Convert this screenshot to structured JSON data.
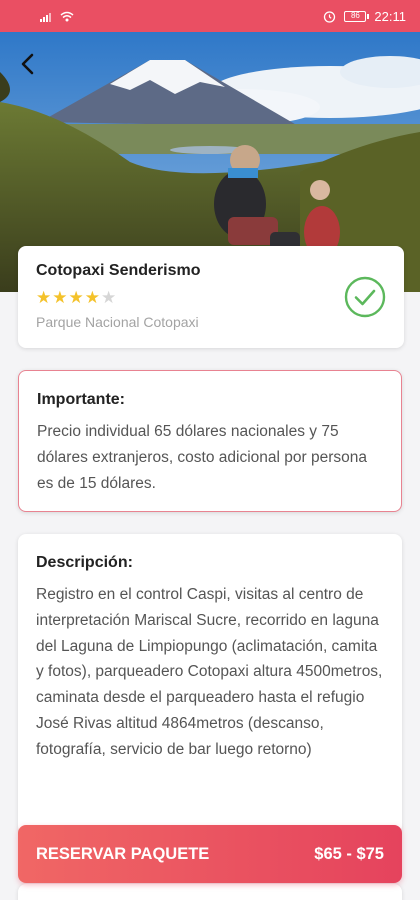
{
  "status_bar": {
    "time": "22:11",
    "battery": "86",
    "icons": [
      "signal-icon",
      "wifi-icon",
      "alarm-icon",
      "battery-icon"
    ]
  },
  "header": {
    "back_icon": "back-arrow-icon"
  },
  "package": {
    "name": "Cotopaxi Senderismo",
    "rating": 4,
    "max_rating": 5,
    "location": "Parque Nacional Cotopaxi",
    "verified_icon": "check-circle-icon"
  },
  "important": {
    "title": "Importante:",
    "text": "Precio individual 65 dólares nacionales y 75  dólares extranjeros,  costo adicional por persona es de 15 dólares."
  },
  "description": {
    "title": "Descripción:",
    "text": "Registro en el control Caspi, visitas al centro de interpretación Mariscal Sucre, recorrido en laguna del Laguna de Limpiopungo (aclimatación, camita y fotos), parqueadero Cotopaxi altura 4500metros, caminata desde el parqueadero hasta el refugio José Rivas altitud 4864metros (descanso, fotografía, servicio de bar luego retorno)"
  },
  "reserve": {
    "label": "RESERVAR PAQUETE",
    "price": "$65 - $75"
  },
  "colors": {
    "accent": "#ea4f63",
    "star": "#f4c22b",
    "check": "#5cb85c",
    "important_border": "#e88391"
  }
}
